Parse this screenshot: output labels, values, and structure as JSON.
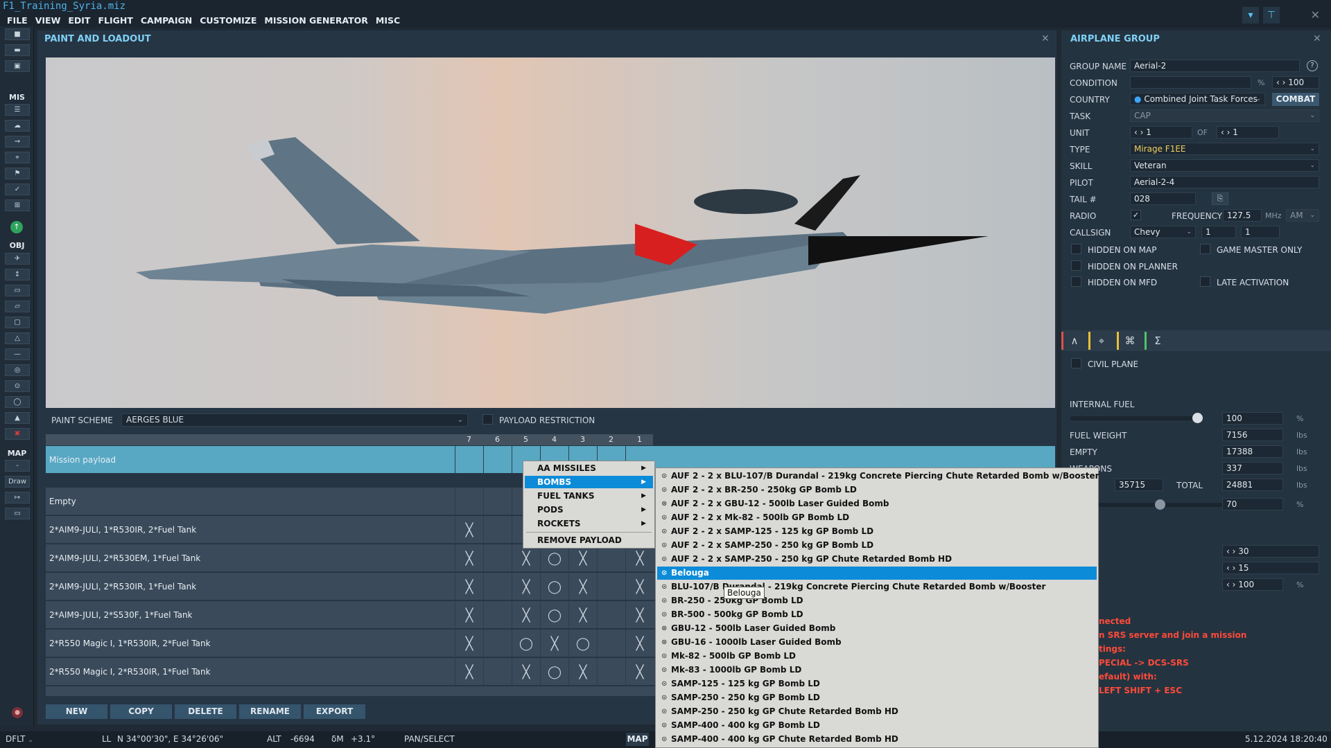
{
  "window": {
    "title": "F1_Training_Syria.miz"
  },
  "menu": [
    "FILE",
    "VIEW",
    "EDIT",
    "FLIGHT",
    "CAMPAIGN",
    "CUSTOMIZE",
    "MISSION GENERATOR",
    "MISC"
  ],
  "left_toolbar": {
    "mis_label": "MIS",
    "obj_label": "OBJ",
    "map_label": "MAP",
    "draw_label": "Draw"
  },
  "paint_loadout": {
    "title": "PAINT AND LOADOUT",
    "paint_scheme_label": "PAINT SCHEME",
    "paint_scheme_value": "AERGES BLUE",
    "payload_restriction_label": "PAYLOAD RESTRICTION",
    "columns": [
      "7",
      "6",
      "5",
      "4",
      "3",
      "2",
      "1"
    ],
    "rows": [
      {
        "name": "Mission payload",
        "selected": true
      },
      {
        "name": "Empty"
      },
      {
        "name": "2*AIM9-JULI, 1*R530IR, 2*Fuel Tank"
      },
      {
        "name": "2*AIM9-JULI, 2*R530EM, 1*Fuel Tank"
      },
      {
        "name": "2*AIM9-JULI, 2*R530IR, 1*Fuel Tank"
      },
      {
        "name": "2*AIM9-JULI, 2*S530F, 1*Fuel Tank"
      },
      {
        "name": "2*R550 Magic I, 1*R530IR, 2*Fuel Tank"
      },
      {
        "name": "2*R550 Magic I, 2*R530IR, 1*Fuel Tank"
      }
    ],
    "buttons": {
      "new": "NEW",
      "copy": "COPY",
      "delete": "DELETE",
      "rename": "RENAME",
      "export": "EXPORT"
    }
  },
  "context_menu": {
    "items": [
      "AA MISSILES",
      "BOMBS",
      "FUEL TANKS",
      "PODS",
      "ROCKETS",
      "REMOVE PAYLOAD"
    ],
    "highlighted": "BOMBS"
  },
  "bombs_submenu": [
    "AUF 2 - 2 x BLU-107/B Durandal - 219kg Concrete Piercing Chute Retarded Bomb w/Booster",
    "AUF 2 - 2 x BR-250 - 250kg GP Bomb LD",
    "AUF 2 - 2 x GBU-12 - 500lb Laser Guided Bomb",
    "AUF 2 - 2 x Mk-82 - 500lb GP Bomb LD",
    "AUF 2 - 2 x SAMP-125 - 125 kg GP Bomb LD",
    "AUF 2 - 2 x SAMP-250 - 250 kg GP Bomb LD",
    "AUF 2 - 2 x SAMP-250 - 250 kg GP Chute Retarded Bomb HD",
    "Belouga",
    "BLU-107/B Durandal - 219kg Concrete Piercing Chute Retarded Bomb w/Booster",
    "BR-250 - 250kg GP Bomb LD",
    "BR-500 - 500kg GP Bomb LD",
    "GBU-12 - 500lb Laser Guided Bomb",
    "GBU-16 - 1000lb Laser Guided Bomb",
    "Mk-82 - 500lb GP Bomb LD",
    "Mk-83 - 1000lb GP Bomb LD",
    "SAMP-125 - 125 kg GP Bomb LD",
    "SAMP-250 - 250 kg GP Bomb LD",
    "SAMP-250 - 250 kg GP Chute Retarded Bomb HD",
    "SAMP-400 - 400 kg GP Bomb LD",
    "SAMP-400 - 400 kg GP Chute Retarded Bomb HD"
  ],
  "bombs_highlighted": "Belouga",
  "tooltip": "Belouga",
  "airplane_group": {
    "title": "AIRPLANE GROUP",
    "group_name_label": "GROUP NAME",
    "group_name": "Aerial-2",
    "condition_label": "CONDITION",
    "condition_unit": "%",
    "condition_value": "100",
    "country_label": "COUNTRY",
    "country": "Combined Joint Task Forces",
    "combat_button": "COMBAT",
    "task_label": "TASK",
    "task": "CAP",
    "unit_label": "UNIT",
    "unit": "1",
    "of_label": "OF",
    "unit_of": "1",
    "type_label": "TYPE",
    "type": "Mirage F1EE",
    "skill_label": "SKILL",
    "skill": "Veteran",
    "pilot_label": "PILOT",
    "pilot": "Aerial-2-4",
    "tail_label": "TAIL #",
    "tail": "028",
    "radio_label": "RADIO",
    "frequency_label": "FREQUENCY",
    "frequency": "127.5",
    "freq_unit": "MHz",
    "modulation": "AM",
    "callsign_label": "CALLSIGN",
    "callsign": "Chevy",
    "callsign_num1": "1",
    "callsign_num2": "1",
    "hidden_on_map": "HIDDEN ON MAP",
    "game_master_only": "GAME MASTER ONLY",
    "hidden_on_planner": "HIDDEN ON PLANNER",
    "hidden_on_mfd": "HIDDEN ON MFD",
    "late_activation": "LATE ACTIVATION",
    "civil_plane": "CIVIL PLANE",
    "internal_fuel_label": "INTERNAL FUEL",
    "internal_fuel": "100",
    "internal_fuel_level": 1.0,
    "pct": "%",
    "fuel_weight_label": "FUEL WEIGHT",
    "fuel_weight": "7156",
    "lbs": "lbs",
    "empty_label": "EMPTY",
    "empty": "17388",
    "weapons_label": "WEAPONS",
    "weapons": "337",
    "max_value": "35715",
    "total_label": "TOTAL",
    "total": "24881",
    "second_slider_value": "70",
    "chaff": "30",
    "flare": "15",
    "gun": "100",
    "srs_msgs": [
      "nected",
      "n SRS server and join a mission",
      "tings:",
      "PECIAL -> DCS-SRS",
      "efault) with:",
      " LEFT SHIFT + ESC"
    ]
  },
  "status_bar": {
    "mode": "DFLT",
    "ll_label": "LL",
    "ll": "N 34°00'30\", E 34°26'06\"",
    "alt_label": "ALT",
    "alt": "-6694",
    "dm_label": "δM",
    "dm": "+3.1°",
    "tool": "PAN/SELECT",
    "map_btn": "MAP",
    "datetime": "5.12.2024 18:20:40"
  }
}
